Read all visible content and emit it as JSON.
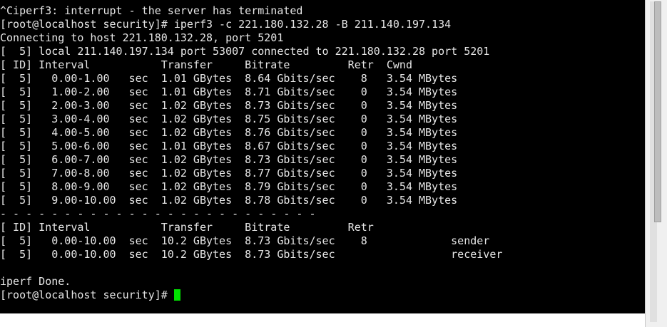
{
  "terminal": {
    "lines": [
      "^Ciperf3: interrupt - the server has terminated",
      "[root@localhost security]# iperf3 -c 221.180.132.28 -B 211.140.197.134",
      "Connecting to host 221.180.132.28, port 5201",
      "[  5] local 211.140.197.134 port 53007 connected to 221.180.132.28 port 5201",
      "[ ID] Interval           Transfer     Bitrate         Retr  Cwnd",
      "[  5]   0.00-1.00   sec  1.01 GBytes  8.64 Gbits/sec    8   3.54 MBytes",
      "[  5]   1.00-2.00   sec  1.01 GBytes  8.71 Gbits/sec    0   3.54 MBytes",
      "[  5]   2.00-3.00   sec  1.02 GBytes  8.73 Gbits/sec    0   3.54 MBytes",
      "[  5]   3.00-4.00   sec  1.02 GBytes  8.75 Gbits/sec    0   3.54 MBytes",
      "[  5]   4.00-5.00   sec  1.02 GBytes  8.76 Gbits/sec    0   3.54 MBytes",
      "[  5]   5.00-6.00   sec  1.01 GBytes  8.67 Gbits/sec    0   3.54 MBytes",
      "[  5]   6.00-7.00   sec  1.02 GBytes  8.73 Gbits/sec    0   3.54 MBytes",
      "[  5]   7.00-8.00   sec  1.02 GBytes  8.77 Gbits/sec    0   3.54 MBytes",
      "[  5]   8.00-9.00   sec  1.02 GBytes  8.79 Gbits/sec    0   3.54 MBytes",
      "[  5]   9.00-10.00  sec  1.02 GBytes  8.78 Gbits/sec    0   3.54 MBytes",
      "- - - - - - - - - - - - - - - - - - - - - - - - -",
      "[ ID] Interval           Transfer     Bitrate         Retr",
      "[  5]   0.00-10.00  sec  10.2 GBytes  8.73 Gbits/sec    8             sender",
      "[  5]   0.00-10.00  sec  10.2 GBytes  8.73 Gbits/sec                  receiver",
      "",
      "iperf Done."
    ],
    "prompt": "[root@localhost security]# ",
    "colors": {
      "background": "#000000",
      "foreground": "#e6e6e6",
      "cursor": "#00e000"
    }
  }
}
